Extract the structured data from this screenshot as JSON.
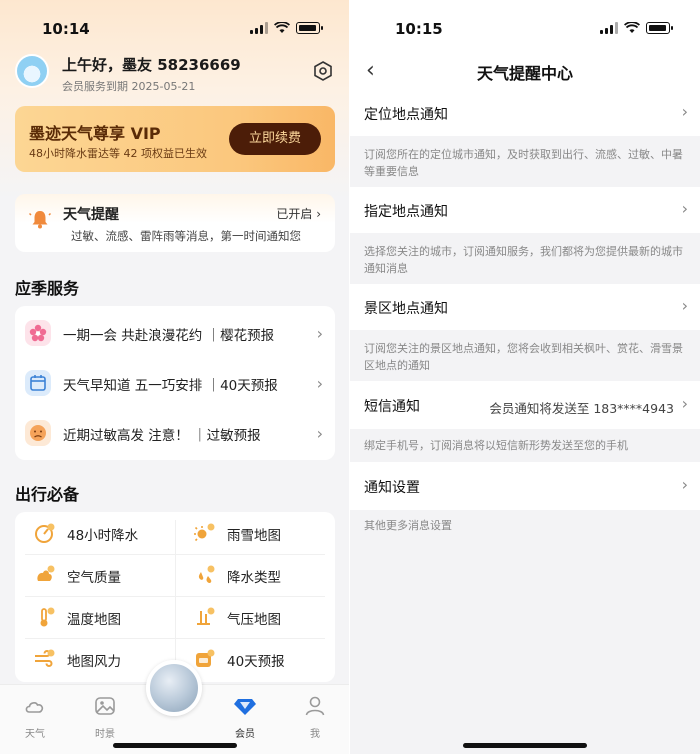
{
  "left": {
    "status": {
      "time": "10:14"
    },
    "header": {
      "greeting": "上午好，墨友 58236669",
      "member_expiry": "会员服务到期 2025-05-21"
    },
    "vip": {
      "title": "墨迹天气尊享 VIP",
      "subtitle": "48小时降水雷达等 42 项权益已生效",
      "button": "立即续费"
    },
    "reminder": {
      "title": "天气提醒",
      "state": "已开启",
      "subtitle": "过敏、流感、雷阵雨等消息，第一时间通知您"
    },
    "seasonal": {
      "title": "应季服务",
      "items": [
        {
          "text": "一期一会 共赴浪漫花约 ｜樱花预报",
          "icon": "sakura-icon"
        },
        {
          "text": "天气早知道 五一巧安排 ｜40天预报",
          "icon": "calendar-icon"
        },
        {
          "text": "近期过敏高发 注意！ ｜过敏预报",
          "icon": "allergy-face-icon"
        }
      ]
    },
    "travel": {
      "title": "出行必备",
      "items": [
        {
          "label": "48小时降水",
          "icon": "rain-radar-icon"
        },
        {
          "label": "雨雪地图",
          "icon": "rain-snow-map-icon"
        },
        {
          "label": "空气质量",
          "icon": "air-quality-icon"
        },
        {
          "label": "降水类型",
          "icon": "precip-type-icon"
        },
        {
          "label": "温度地图",
          "icon": "temperature-map-icon"
        },
        {
          "label": "气压地图",
          "icon": "pressure-map-icon"
        },
        {
          "label": "地图风力",
          "icon": "wind-map-icon"
        },
        {
          "label": "40天预报",
          "icon": "forecast-40-icon"
        }
      ]
    },
    "tabs": [
      {
        "label": "天气",
        "icon": "cloud-icon"
      },
      {
        "label": "时景",
        "icon": "photo-icon"
      },
      {
        "label": "会员",
        "icon": "vip-diamond-icon"
      },
      {
        "label": "我",
        "icon": "user-icon"
      }
    ]
  },
  "right": {
    "status": {
      "time": "10:15"
    },
    "title": "天气提醒中心",
    "rows": [
      {
        "label": "定位地点通知",
        "value": "",
        "desc": "订阅您所在的定位城市通知，及时获取到出行、流感、过敏、中暑等重要信息"
      },
      {
        "label": "指定地点通知",
        "value": "",
        "desc": "选择您关注的城市，订阅通知服务，我们都将为您提供最新的城市通知消息"
      },
      {
        "label": "景区地点通知",
        "value": "",
        "desc": "订阅您关注的景区地点通知，您将会收到相关枫叶、赏花、滑雪景区地点的通知"
      },
      {
        "label": "短信通知",
        "value": "会员通知将发送至 183****4943",
        "desc": "绑定手机号，订阅消息将以短信新形势发送至您的手机"
      },
      {
        "label": "通知设置",
        "value": "",
        "desc": "其他更多消息设置"
      }
    ]
  },
  "colors": {
    "accent": "#4c1d08",
    "vip_gold": "#fbc77d",
    "orange": "#f5a623"
  }
}
